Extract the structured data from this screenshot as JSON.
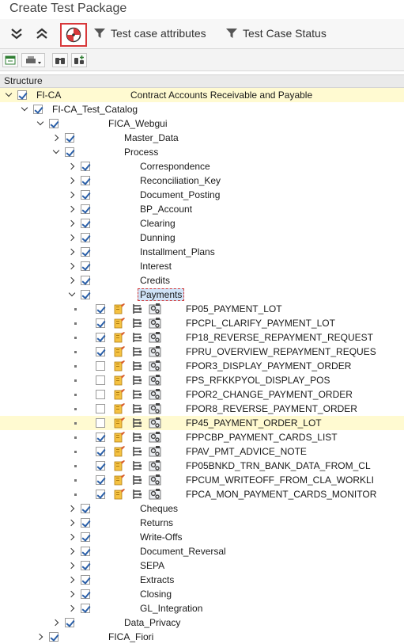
{
  "window": {
    "title": "Create Test Package"
  },
  "toolbar": {
    "expand_all_icon": "double-chevron-down-icon",
    "collapse_all_icon": "double-chevron-up-icon",
    "target_icon": "target-icon",
    "test_case_attributes_label": "Test case attributes",
    "test_case_status_label": "Test Case Status",
    "filter_icon": "funnel-icon"
  },
  "subtoolbar": {
    "buttons": [
      "export-icon",
      "print-icon",
      "find-icon",
      "find-next-icon"
    ]
  },
  "tree": {
    "header": "Structure",
    "rows": [
      {
        "indent": 0,
        "caret": "down",
        "checked": true,
        "label": "FI-CA",
        "desc": "Contract Accounts Receivable and Payable",
        "highlight": true
      },
      {
        "indent": 1,
        "caret": "down",
        "checked": true,
        "label": "FI-CA_Test_Catalog"
      },
      {
        "indent": 2,
        "caret": "down",
        "checked": true,
        "label": "FICA_Webgui"
      },
      {
        "indent": 3,
        "caret": "right",
        "checked": true,
        "label": "Master_Data"
      },
      {
        "indent": 3,
        "caret": "down",
        "checked": true,
        "label": "Process"
      },
      {
        "indent": 4,
        "caret": "right",
        "checked": true,
        "label": "Correspondence"
      },
      {
        "indent": 4,
        "caret": "right",
        "checked": true,
        "label": "Reconciliation_Key"
      },
      {
        "indent": 4,
        "caret": "right",
        "checked": true,
        "label": "Document_Posting"
      },
      {
        "indent": 4,
        "caret": "right",
        "checked": true,
        "label": "BP_Account"
      },
      {
        "indent": 4,
        "caret": "right",
        "checked": true,
        "label": "Clearing"
      },
      {
        "indent": 4,
        "caret": "right",
        "checked": true,
        "label": "Dunning"
      },
      {
        "indent": 4,
        "caret": "right",
        "checked": true,
        "label": "Installment_Plans"
      },
      {
        "indent": 4,
        "caret": "right",
        "checked": true,
        "label": "Interest"
      },
      {
        "indent": 4,
        "caret": "right",
        "checked": true,
        "label": "Credits"
      },
      {
        "indent": 4,
        "caret": "down",
        "checked": true,
        "label": "Payments",
        "selected": true
      },
      {
        "leaf": true,
        "checked": true,
        "label": "FP05_PAYMENT_LOT"
      },
      {
        "leaf": true,
        "checked": true,
        "label": "FPCPL_CLARIFY_PAYMENT_LOT"
      },
      {
        "leaf": true,
        "checked": true,
        "label": "FP18_REVERSE_REPAYMENT_REQUEST"
      },
      {
        "leaf": true,
        "checked": true,
        "label": "FPRU_OVERVIEW_REPAYMENT_REQUES"
      },
      {
        "leaf": true,
        "checked": false,
        "label": "FPOR3_DISPLAY_PAYMENT_ORDER"
      },
      {
        "leaf": true,
        "checked": false,
        "label": "FPS_RFKKPYOL_DISPLAY_POS"
      },
      {
        "leaf": true,
        "checked": false,
        "label": "FPOR2_CHANGE_PAYMENT_ORDER"
      },
      {
        "leaf": true,
        "checked": false,
        "label": "FPOR8_REVERSE_PAYMENT_ORDER"
      },
      {
        "leaf": true,
        "checked": false,
        "label": "FP45_PAYMENT_ORDER_LOT",
        "highlight": true
      },
      {
        "leaf": true,
        "checked": true,
        "label": "FPPCBP_PAYMENT_CARDS_LIST"
      },
      {
        "leaf": true,
        "checked": true,
        "label": "FPAV_PMT_ADVICE_NOTE"
      },
      {
        "leaf": true,
        "checked": true,
        "label": "FP05BNKD_TRN_BANK_DATA_FROM_CL"
      },
      {
        "leaf": true,
        "checked": true,
        "label": "FPCUM_WRITEOFF_FROM_CLA_WORKLI"
      },
      {
        "leaf": true,
        "checked": true,
        "label": "FPCA_MON_PAYMENT_CARDS_MONITOR"
      },
      {
        "indent": 4,
        "caret": "right",
        "checked": true,
        "label": "Cheques"
      },
      {
        "indent": 4,
        "caret": "right",
        "checked": true,
        "label": "Returns"
      },
      {
        "indent": 4,
        "caret": "right",
        "checked": true,
        "label": "Write-Offs"
      },
      {
        "indent": 4,
        "caret": "right",
        "checked": true,
        "label": "Document_Reversal"
      },
      {
        "indent": 4,
        "caret": "right",
        "checked": true,
        "label": "SEPA"
      },
      {
        "indent": 4,
        "caret": "right",
        "checked": true,
        "label": "Extracts"
      },
      {
        "indent": 4,
        "caret": "right",
        "checked": true,
        "label": "Closing"
      },
      {
        "indent": 4,
        "caret": "right",
        "checked": true,
        "label": "GL_Integration"
      },
      {
        "indent": 3,
        "caret": "right",
        "checked": true,
        "label": "Data_Privacy"
      },
      {
        "indent": 2,
        "caret": "right",
        "checked": true,
        "label": "FICA_Fiori"
      }
    ]
  },
  "colors": {
    "highlight_row": "#fffad1",
    "selection": "#cfe3f7",
    "focus_border": "#d23a3a",
    "check": "#2a5fa8"
  }
}
